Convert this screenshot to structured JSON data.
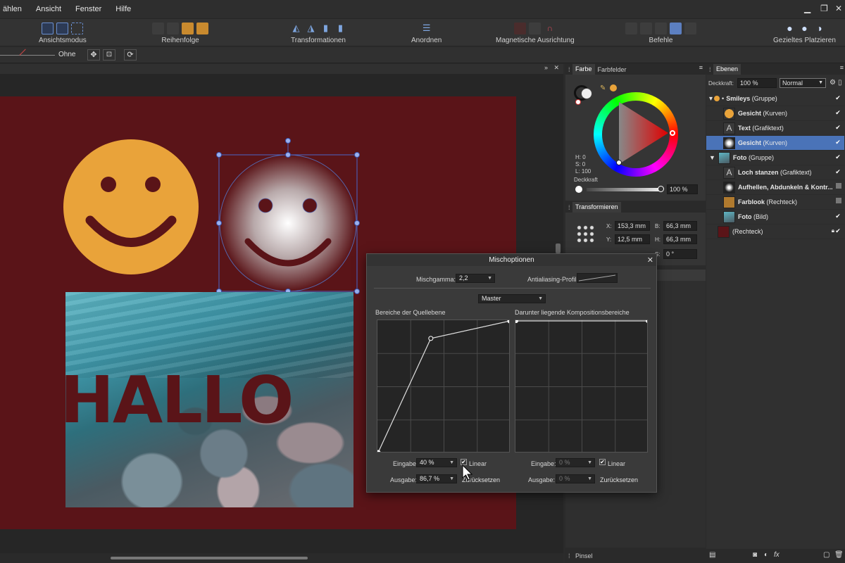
{
  "menu": [
    "ählen",
    "Ansicht",
    "Fenster",
    "Hilfe"
  ],
  "toolbar": {
    "groups": [
      "Ansichtsmodus",
      "Reihenfolge",
      "Transformationen",
      "Anordnen",
      "Magnetische Ausrichtung",
      "Befehle",
      "Gezieltes Platzieren"
    ]
  },
  "context": {
    "stroke_label": "Ohne"
  },
  "canvas": {
    "text": "HALLO"
  },
  "color_panel": {
    "tabs": [
      "Farbe",
      "Farbfelder"
    ],
    "hsl": [
      "H: 0",
      "S: 0",
      "L: 100"
    ],
    "opacity_label": "Deckkraft",
    "opacity_value": "100 %"
  },
  "transform_panel": {
    "tab": "Transformieren",
    "x_label": "X:",
    "x": "153,3 mm",
    "y_label": "Y:",
    "y": "12,5 mm",
    "b_label": "B:",
    "b": "66,3 mm",
    "h_label": "H:",
    "h": "66,3 mm",
    "s_label": "S:",
    "s": "0 °"
  },
  "brush_panel": {
    "tab": "Pinsel"
  },
  "layers_panel": {
    "tab": "Ebenen",
    "opacity_label": "Deckkraft:",
    "opacity_value": "100 %",
    "blend_mode": "Normal",
    "items": [
      {
        "name": "Smileys",
        "type": "(Gruppe)"
      },
      {
        "name": "Gesicht",
        "type": "(Kurven)"
      },
      {
        "name": "Text",
        "type": "(Grafiktext)"
      },
      {
        "name": "Gesicht",
        "type": "(Kurven)"
      },
      {
        "name": "Foto",
        "type": "(Gruppe)"
      },
      {
        "name": "Loch stanzen",
        "type": "(Grafiktext)"
      },
      {
        "name": "Aufhellen, Abdunkeln & Kontr...",
        "type": ""
      },
      {
        "name": "Farblook",
        "type": "(Rechteck)"
      },
      {
        "name": "Foto",
        "type": "(Bild)"
      },
      {
        "name": "",
        "type": "(Rechteck)"
      }
    ]
  },
  "dialog": {
    "title": "Mischoptionen",
    "gamma_label": "Mischgamma:",
    "gamma_value": "2,2",
    "aa_label": "Antialiasing-Profil:",
    "channel": "Master",
    "source_label": "Bereiche der Quellebene",
    "dest_label": "Darunter liegende Kompositionsbereiche",
    "input_label": "Eingabe:",
    "output_label": "Ausgabe:",
    "src_input": "40 %",
    "src_output": "86,7 %",
    "dst_input": "0 %",
    "dst_output": "0 %",
    "linear_label": "Linear",
    "reset_label": "Zurücksetzen",
    "curve_source": [
      [
        0,
        0
      ],
      [
        40,
        86.7
      ],
      [
        100,
        100
      ]
    ]
  },
  "colors": {
    "artboard": "#5a1418",
    "smiley": "#e9a33a",
    "selection": "#4a73b8"
  }
}
